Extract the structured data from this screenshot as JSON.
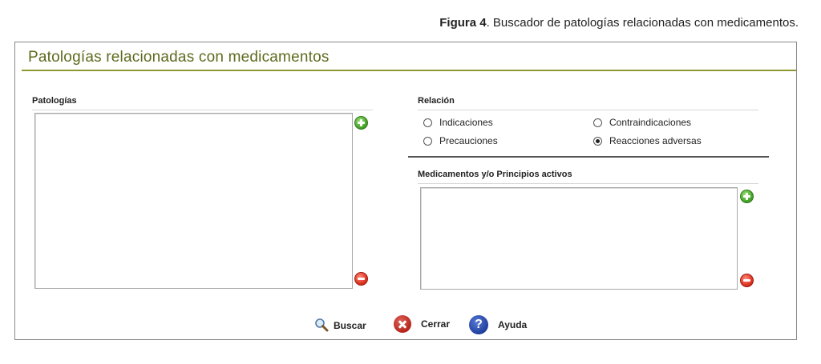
{
  "caption": {
    "label": "Figura 4",
    "text": ". Buscador de patologías relacionadas con medicamentos."
  },
  "panel": {
    "title": "Patologías relacionadas con medicamentos"
  },
  "pathologies": {
    "label": "Patologías"
  },
  "relation": {
    "label": "Relación",
    "options": [
      {
        "label": "Indicaciones",
        "checked": false
      },
      {
        "label": "Contraindicaciones",
        "checked": false
      },
      {
        "label": "Precauciones",
        "checked": false
      },
      {
        "label": "Reacciones adversas",
        "checked": true
      }
    ]
  },
  "medications": {
    "label": "Medicamentos y/o Principios activos"
  },
  "actions": {
    "search": "Buscar",
    "close": "Cerrar",
    "help": "Ayuda",
    "help_glyph": "?"
  },
  "icons": {
    "add": "plus-circle-icon",
    "remove": "minus-circle-icon",
    "search": "magnifier-icon",
    "close": "x-circle-icon",
    "help": "question-circle-icon"
  },
  "colors": {
    "title": "#5e6a1d",
    "title_rule": "#8d9a32",
    "add": "#4aa72c",
    "remove": "#de3522",
    "help": "#1f3f9e"
  }
}
